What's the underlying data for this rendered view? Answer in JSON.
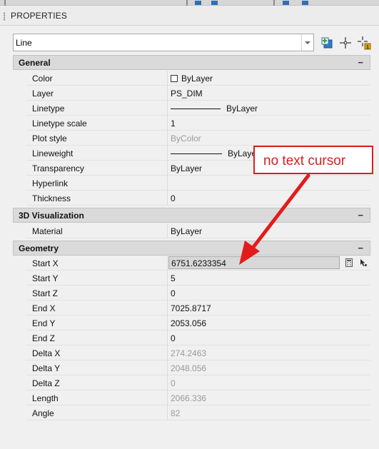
{
  "palette": {
    "title": "PROPERTIES"
  },
  "selector": {
    "value": "Line"
  },
  "toolbar": {
    "quick_select_icon": "quick-select-icon",
    "select_objects_icon": "select-objects-icon",
    "toggle_pickadd_icon": "toggle-pickadd-icon"
  },
  "sections": {
    "general": {
      "title": "General",
      "toggle": "−"
    },
    "visualization": {
      "title": "3D Visualization",
      "toggle": "−"
    },
    "geometry": {
      "title": "Geometry",
      "toggle": "−"
    }
  },
  "general": [
    {
      "label": "Color",
      "value": "ByLayer"
    },
    {
      "label": "Layer",
      "value": "PS_DIM"
    },
    {
      "label": "Linetype",
      "value": "ByLayer"
    },
    {
      "label": "Linetype scale",
      "value": "1"
    },
    {
      "label": "Plot style",
      "value": "ByColor"
    },
    {
      "label": "Lineweight",
      "value": "ByLayer"
    },
    {
      "label": "Transparency",
      "value": "ByLayer"
    },
    {
      "label": "Hyperlink",
      "value": ""
    },
    {
      "label": "Thickness",
      "value": "0"
    }
  ],
  "visualization": [
    {
      "label": "Material",
      "value": "ByLayer"
    }
  ],
  "geometry": [
    {
      "label": "Start X",
      "value": "6751.6233354"
    },
    {
      "label": "Start Y",
      "value": "5"
    },
    {
      "label": "Start Z",
      "value": "0"
    },
    {
      "label": "End X",
      "value": "7025.8717"
    },
    {
      "label": "End Y",
      "value": "2053.056"
    },
    {
      "label": "End Z",
      "value": "0"
    },
    {
      "label": "Delta X",
      "value": "274.2463"
    },
    {
      "label": "Delta Y",
      "value": "2048.056"
    },
    {
      "label": "Delta Z",
      "value": "0"
    },
    {
      "label": "Length",
      "value": "2066.336"
    },
    {
      "label": "Angle",
      "value": "82"
    }
  ],
  "callout": {
    "text": "no text cursor"
  },
  "colors": {
    "callout": "#d62020",
    "section_bg": "#dadada",
    "panel_bg": "#f0f0f0"
  }
}
